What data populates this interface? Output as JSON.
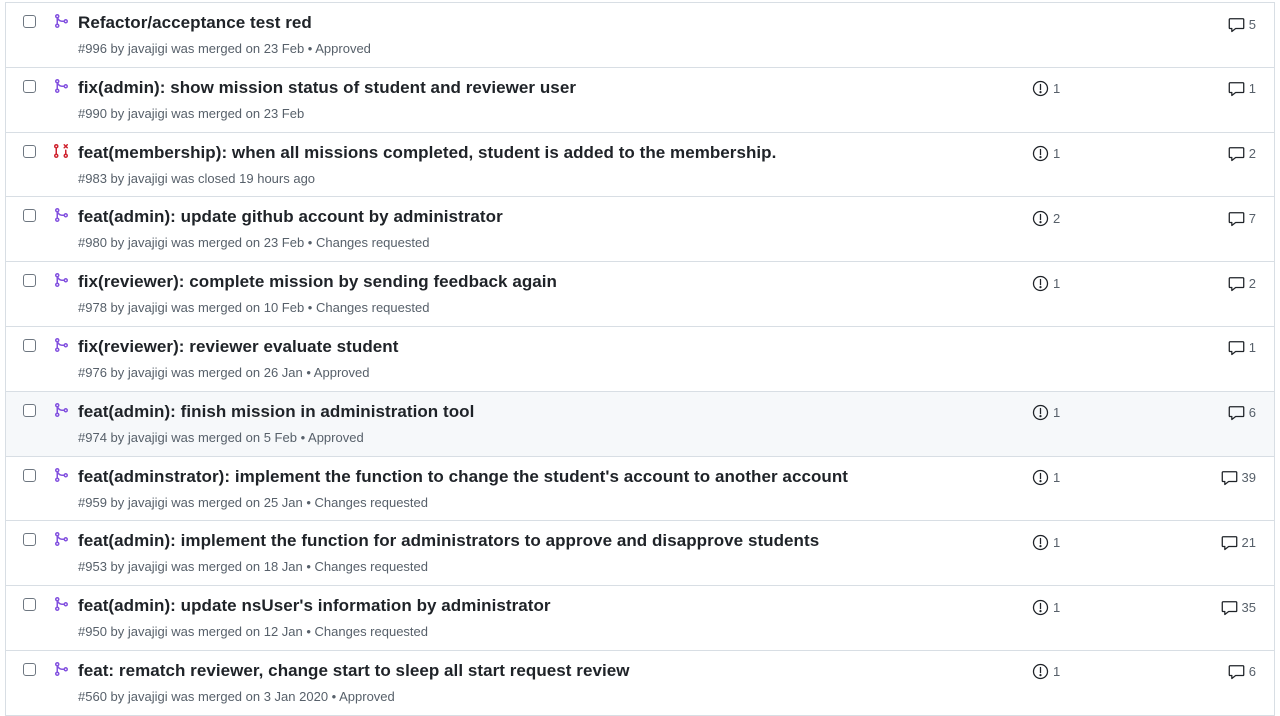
{
  "colors": {
    "merged": "#8250df",
    "closed": "#cf222e",
    "muted": "#57606a"
  },
  "pull_requests": [
    {
      "state": "merged",
      "icon": "git-merge-icon",
      "title": "Refactor/acceptance test red",
      "meta": "#996 by javajigi was merged on 23 Feb • Approved",
      "issues": "",
      "comments": "5"
    },
    {
      "state": "merged",
      "icon": "git-merge-icon",
      "title": "fix(admin): show mission status of student and reviewer user",
      "meta": "#990 by javajigi was merged on 23 Feb",
      "issues": "1",
      "comments": "1"
    },
    {
      "state": "closed",
      "icon": "git-pull-request-closed-icon",
      "title": "feat(membership): when all missions completed, student is added to the membership.",
      "meta": "#983 by javajigi was closed 19 hours ago",
      "issues": "1",
      "comments": "2"
    },
    {
      "state": "merged",
      "icon": "git-merge-icon",
      "title": "feat(admin): update github account by administrator",
      "meta": "#980 by javajigi was merged on 23 Feb • Changes requested",
      "issues": "2",
      "comments": "7"
    },
    {
      "state": "merged",
      "icon": "git-merge-icon",
      "title": "fix(reviewer): complete mission by sending feedback again",
      "meta": "#978 by javajigi was merged on 10 Feb • Changes requested",
      "issues": "1",
      "comments": "2"
    },
    {
      "state": "merged",
      "icon": "git-merge-icon",
      "title": "fix(reviewer): reviewer evaluate student",
      "meta": "#976 by javajigi was merged on 26 Jan • Approved",
      "issues": "",
      "comments": "1"
    },
    {
      "state": "merged",
      "icon": "git-merge-icon",
      "title": "feat(admin): finish mission in administration tool",
      "meta": "#974 by javajigi was merged on 5 Feb • Approved",
      "issues": "1",
      "comments": "6",
      "hover": true
    },
    {
      "state": "merged",
      "icon": "git-merge-icon",
      "title": "feat(adminstrator): implement the function to change the student's account to another account",
      "meta": "#959 by javajigi was merged on 25 Jan • Changes requested",
      "issues": "1",
      "comments": "39"
    },
    {
      "state": "merged",
      "icon": "git-merge-icon",
      "title": "feat(admin): implement the function for administrators to approve and disapprove students",
      "meta": "#953 by javajigi was merged on 18 Jan • Changes requested",
      "issues": "1",
      "comments": "21"
    },
    {
      "state": "merged",
      "icon": "git-merge-icon",
      "title": "feat(admin): update nsUser's information by administrator",
      "meta": "#950 by javajigi was merged on 12 Jan • Changes requested",
      "issues": "1",
      "comments": "35"
    },
    {
      "state": "merged",
      "icon": "git-merge-icon",
      "title": "feat: rematch reviewer, change start to sleep all start request review",
      "meta": "#560 by javajigi was merged on 3 Jan 2020 • Approved",
      "issues": "1",
      "comments": "6"
    }
  ]
}
